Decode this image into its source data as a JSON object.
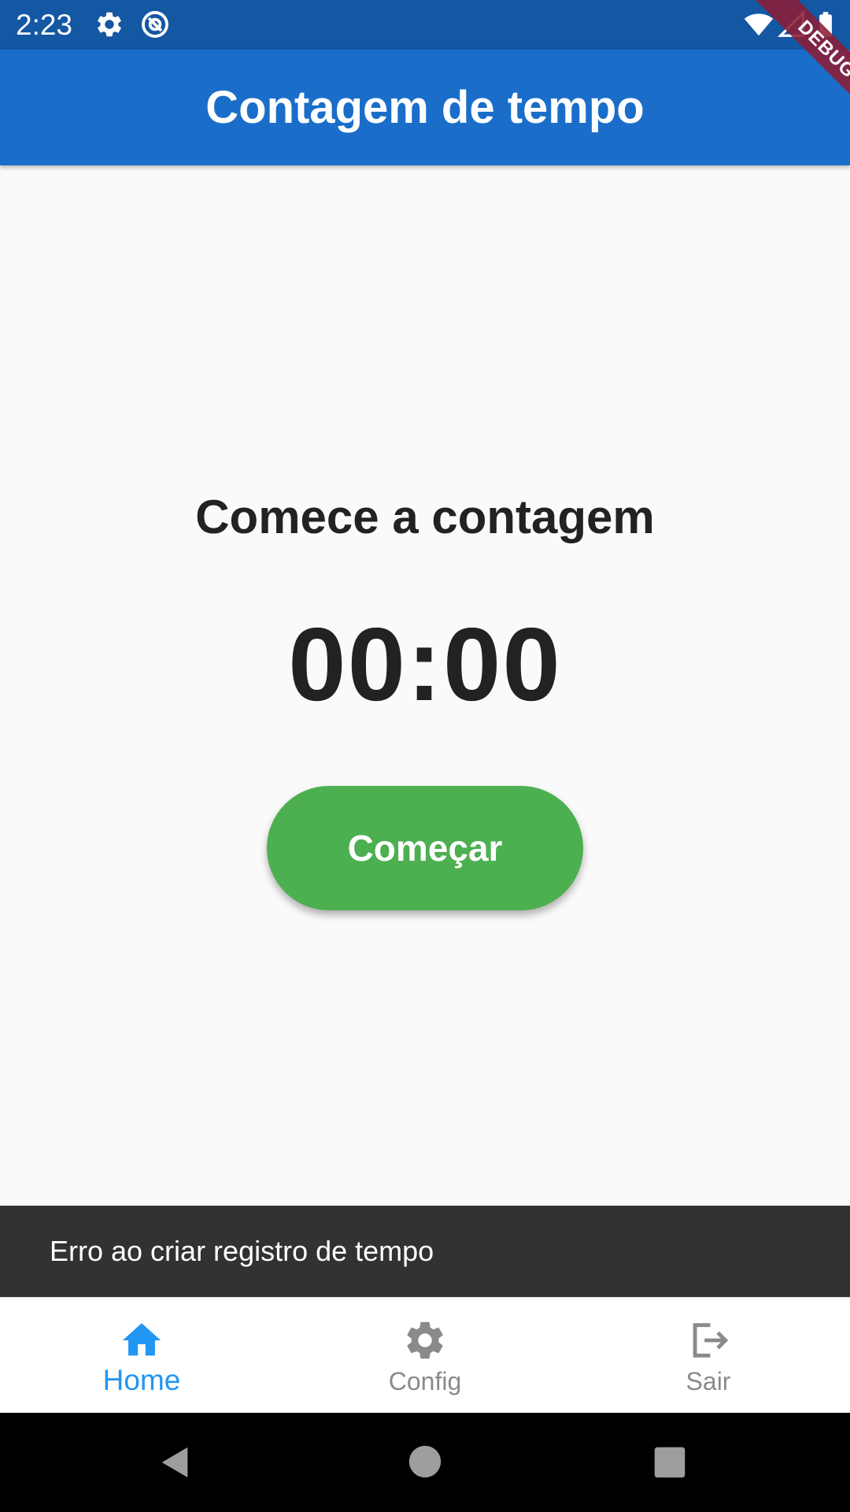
{
  "status_bar": {
    "time": "2:23",
    "icons": [
      "gear-icon",
      "at-sign-icon",
      "wifi-icon",
      "signal-icon",
      "battery-icon"
    ]
  },
  "debug_banner": {
    "label": "DEBUG"
  },
  "app_bar": {
    "title": "Contagem de tempo",
    "color": "#1a6ec9"
  },
  "main": {
    "subtitle": "Comece a contagem",
    "timer": "00:00",
    "start_button_label": "Começar",
    "start_button_color": "#4caf50"
  },
  "snackbar": {
    "message": "Erro ao criar registro de tempo"
  },
  "bottom_nav": {
    "items": [
      {
        "label": "Home",
        "icon": "home-icon",
        "active": true
      },
      {
        "label": "Config",
        "icon": "gear-icon",
        "active": false
      },
      {
        "label": "Sair",
        "icon": "logout-icon",
        "active": false
      }
    ],
    "active_color": "#2196f3",
    "inactive_color": "#8a8a8a"
  },
  "system_nav": {
    "icons": [
      "back-icon",
      "home-circle-icon",
      "recents-icon"
    ]
  }
}
